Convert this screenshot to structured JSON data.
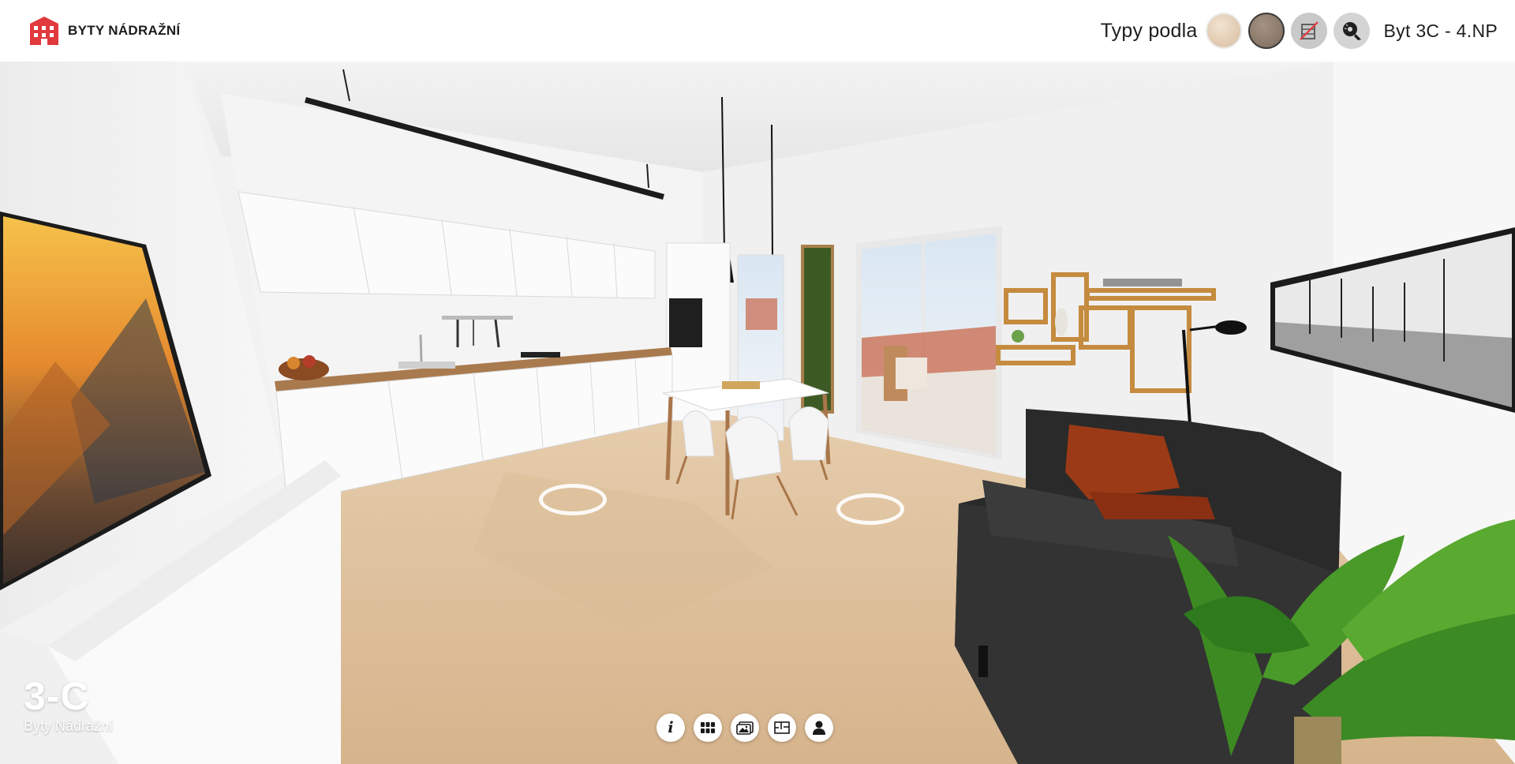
{
  "brand": {
    "name": "BYTY NÁDRAŽNÍ",
    "logo_icon": "building-logo-icon",
    "color": "#e0393e"
  },
  "header": {
    "types_label": "Typy podla",
    "unit_label": "Byt 3C - 4.NP",
    "swatches": [
      {
        "name": "light-wood-finish",
        "color": "#e3cdb4",
        "selected": false
      },
      {
        "name": "dark-wood-finish",
        "color": "#8c7a6b",
        "selected": true
      },
      {
        "name": "no-furniture",
        "icon": "furniture-off-icon"
      },
      {
        "name": "measurements",
        "icon": "tape-measure-icon"
      }
    ]
  },
  "unit": {
    "code": "3-C",
    "subtitle": "Byty Nádražní"
  },
  "toolbar": {
    "buttons": [
      {
        "name": "info",
        "icon": "info-icon"
      },
      {
        "name": "grid",
        "icon": "grid-icon"
      },
      {
        "name": "gallery",
        "icon": "gallery-icon"
      },
      {
        "name": "floorplan",
        "icon": "floorplan-icon"
      },
      {
        "name": "contact",
        "icon": "person-icon"
      }
    ]
  },
  "scene": {
    "description_icon": "panorama-view",
    "hotspots": 2
  }
}
